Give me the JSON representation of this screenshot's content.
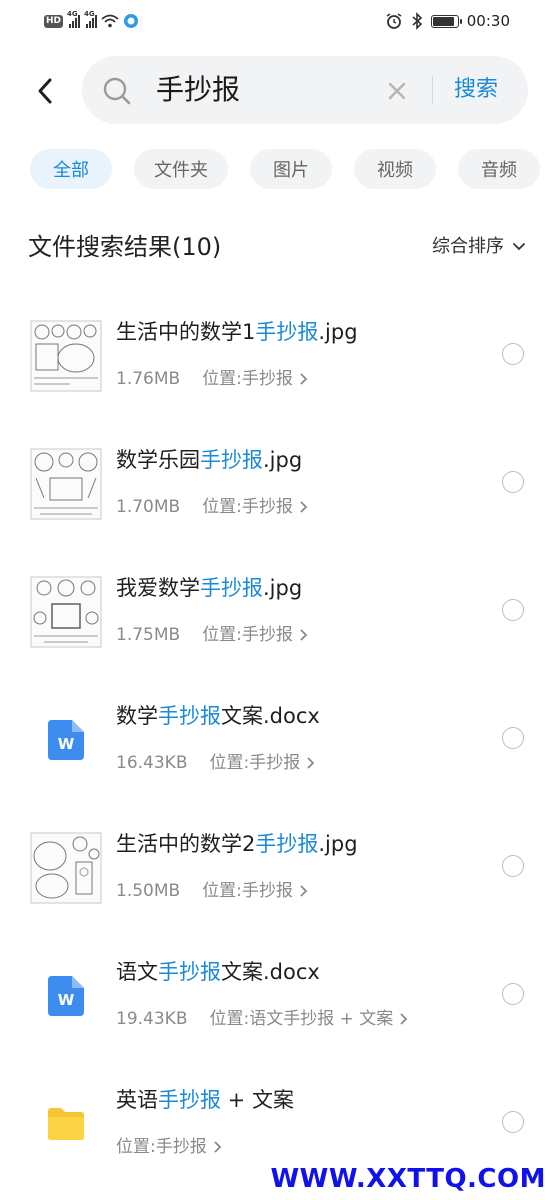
{
  "status_bar": {
    "time": "00:30",
    "hd_label": "HD",
    "network_1": "4G",
    "network_2": "4G",
    "battery_level": 0.95
  },
  "search": {
    "query": "手抄报",
    "button_label": "搜索"
  },
  "tabs": [
    {
      "label": "全部",
      "active": true
    },
    {
      "label": "文件夹",
      "active": false
    },
    {
      "label": "图片",
      "active": false
    },
    {
      "label": "视频",
      "active": false
    },
    {
      "label": "音频",
      "active": false
    }
  ],
  "results": {
    "title": "文件搜索结果(10)",
    "sort_label": "综合排序"
  },
  "items": [
    {
      "type": "image",
      "name_prefix": "生活中的数学1",
      "name_highlight": "手抄报",
      "name_suffix": ".jpg",
      "size": "1.76MB",
      "location_label": "位置:",
      "location": "手抄报"
    },
    {
      "type": "image",
      "name_prefix": "数学乐园",
      "name_highlight": "手抄报",
      "name_suffix": ".jpg",
      "size": "1.70MB",
      "location_label": "位置:",
      "location": "手抄报"
    },
    {
      "type": "image",
      "name_prefix": "我爱数学",
      "name_highlight": "手抄报",
      "name_suffix": ".jpg",
      "size": "1.75MB",
      "location_label": "位置:",
      "location": "手抄报"
    },
    {
      "type": "doc",
      "name_prefix": "数学",
      "name_highlight": "手抄报",
      "name_suffix": "文案.docx",
      "size": "16.43KB",
      "location_label": "位置:",
      "location": "手抄报"
    },
    {
      "type": "image",
      "name_prefix": "生活中的数学2",
      "name_highlight": "手抄报",
      "name_suffix": ".jpg",
      "size": "1.50MB",
      "location_label": "位置:",
      "location": "手抄报"
    },
    {
      "type": "doc",
      "name_prefix": "语文",
      "name_highlight": "手抄报",
      "name_suffix": "文案.docx",
      "size": "19.43KB",
      "location_label": "位置:",
      "location": "语文手抄报 + 文案"
    },
    {
      "type": "folder",
      "name_prefix": "英语",
      "name_highlight": "手抄报",
      "name_suffix": " + 文案",
      "size": "",
      "location_label": "位置:",
      "location": "手抄报"
    }
  ],
  "watermark": "WWW.XXTTQ.COM",
  "colors": {
    "accent": "#1a8ad6",
    "doc_icon": "#3d8cf0",
    "folder_icon": "#f6c531"
  }
}
